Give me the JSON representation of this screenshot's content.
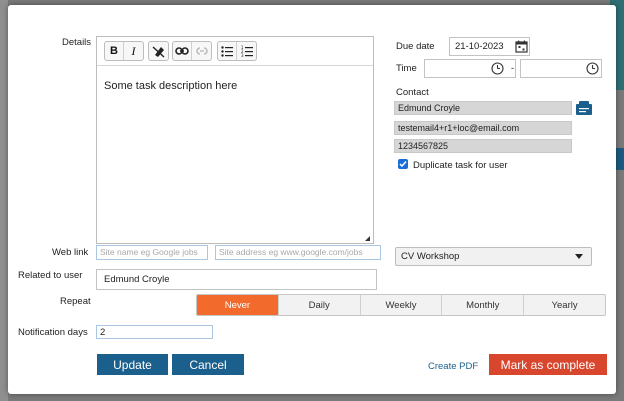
{
  "details": {
    "label": "Details",
    "toolbar_bold": "B",
    "toolbar_italic": "I",
    "body": "Some task description here"
  },
  "due": {
    "date_label": "Due date",
    "date_value": "21-10-2023",
    "time_label": "Time",
    "time_separator": "-"
  },
  "contact": {
    "label": "Contact",
    "name": "Edmund Croyle",
    "email": "testemail4+r1+loc@email.com",
    "phone": "1234567825",
    "duplicate_label": "Duplicate task for user",
    "duplicate_checked": true
  },
  "web_link": {
    "label": "Web link",
    "name_placeholder": "Site name eg Google jobs",
    "address_placeholder": "Site address eg www.google.com/jobs"
  },
  "workshop_select": {
    "value": "CV Workshop"
  },
  "related": {
    "label": "Related to user",
    "value": "Edmund Croyle"
  },
  "repeat": {
    "label": "Repeat",
    "options": [
      "Never",
      "Daily",
      "Weekly",
      "Monthly",
      "Yearly"
    ],
    "selected": "Never"
  },
  "notification": {
    "label": "Notification days",
    "value": "2"
  },
  "actions": {
    "update": "Update",
    "cancel": "Cancel",
    "create_pdf": "Create PDF",
    "mark_complete": "Mark as complete"
  },
  "colors": {
    "accent_blue": "#1b5f8c",
    "accent_orange": "#f26a2c",
    "danger_red": "#d8462e"
  }
}
